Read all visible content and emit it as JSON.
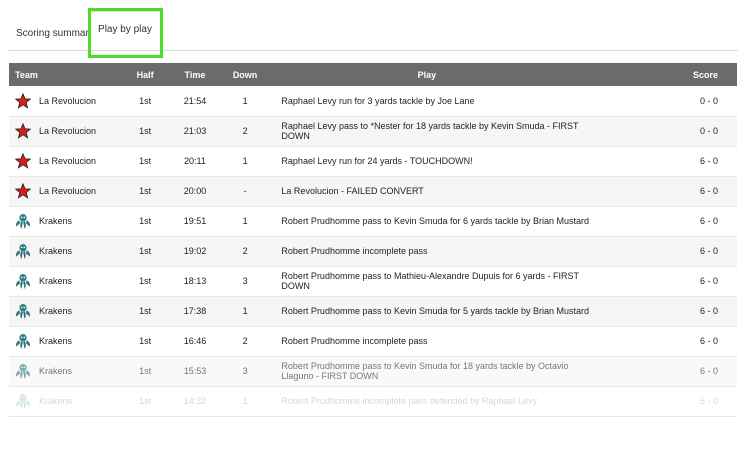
{
  "tabs": {
    "scoring_summary": "Scoring summary",
    "play_by_play": "Play by play"
  },
  "table": {
    "headers": {
      "team": "Team",
      "half": "Half",
      "time": "Time",
      "down": "Down",
      "play": "Play",
      "score": "Score"
    },
    "rows": [
      {
        "team": "La Revolucion",
        "logo": "red-star-icon",
        "half": "1st",
        "time": "21:54",
        "down": "1",
        "play": "Raphael Levy run for 3 yards tackle by Joe Lane",
        "score": "0 - 0"
      },
      {
        "team": "La Revolucion",
        "logo": "red-star-icon",
        "half": "1st",
        "time": "21:03",
        "down": "2",
        "play": "Raphael Levy pass to *Nester for 18 yards tackle by Kevin Smuda - FIRST DOWN",
        "score": "0 - 0"
      },
      {
        "team": "La Revolucion",
        "logo": "red-star-icon",
        "half": "1st",
        "time": "20:11",
        "down": "1",
        "play": "Raphael Levy run for 24 yards - TOUCHDOWN!",
        "score": "6 - 0"
      },
      {
        "team": "La Revolucion",
        "logo": "red-star-icon",
        "half": "1st",
        "time": "20:00",
        "down": "-",
        "play": "La Revolucion - FAILED CONVERT",
        "score": "6 - 0"
      },
      {
        "team": "Krakens",
        "logo": "kraken-icon",
        "half": "1st",
        "time": "19:51",
        "down": "1",
        "play": "Robert Prudhomme pass to Kevin Smuda for 6 yards tackle by Brian Mustard",
        "score": "6 - 0"
      },
      {
        "team": "Krakens",
        "logo": "kraken-icon",
        "half": "1st",
        "time": "19:02",
        "down": "2",
        "play": "Robert Prudhomme incomplete pass",
        "score": "6 - 0"
      },
      {
        "team": "Krakens",
        "logo": "kraken-icon",
        "half": "1st",
        "time": "18:13",
        "down": "3",
        "play": "Robert Prudhomme pass to Mathieu-Alexandre Dupuis for 6 yards - FIRST DOWN",
        "score": "6 - 0"
      },
      {
        "team": "Krakens",
        "logo": "kraken-icon",
        "half": "1st",
        "time": "17:38",
        "down": "1",
        "play": "Robert Prudhomme pass to Kevin Smuda for 5 yards tackle by Brian Mustard",
        "score": "6 - 0"
      },
      {
        "team": "Krakens",
        "logo": "kraken-icon",
        "half": "1st",
        "time": "16:46",
        "down": "2",
        "play": "Robert Prudhomme incomplete pass",
        "score": "6 - 0"
      },
      {
        "team": "Krakens",
        "logo": "kraken-icon",
        "half": "1st",
        "time": "15:53",
        "down": "3",
        "play": "Robert Prudhomme pass to Kevin Smuda for 18 yards tackle by Octavio Llaguno - FIRST DOWN",
        "score": "6 - 0"
      },
      {
        "team": "Krakens",
        "logo": "kraken-icon",
        "half": "1st",
        "time": "14:32",
        "down": "1",
        "play": "Robert Prudhomme incomplete pass defended by Raphael Levy",
        "score": "6 - 0"
      }
    ]
  },
  "colors": {
    "header_bg": "#6b6b6b",
    "tab_highlight": "#4cdc2a",
    "star_red": "#d91e18",
    "kraken_teal": "#2f7f86"
  }
}
